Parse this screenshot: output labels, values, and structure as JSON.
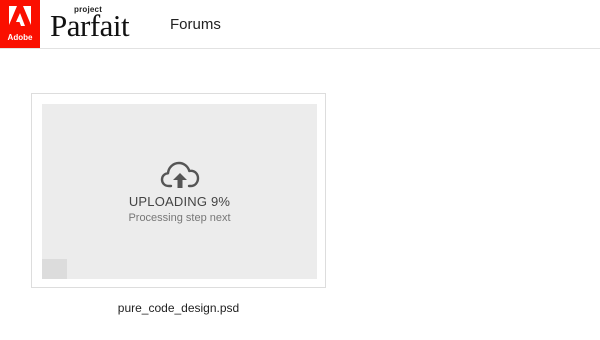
{
  "header": {
    "logo_text": "Adobe",
    "brand_small": "project",
    "brand_name": "Parfait",
    "nav_forums": "Forums"
  },
  "colors": {
    "adobe_red": "#fa0f00",
    "preview_bg": "#ececec",
    "card_border": "#dddddd"
  },
  "file_card": {
    "icon": "cloud-upload-icon",
    "status_text": "UPLOADING 9%",
    "progress_percent": 9,
    "sub_status": "Processing step next",
    "file_name": "pure_code_design.psd"
  }
}
